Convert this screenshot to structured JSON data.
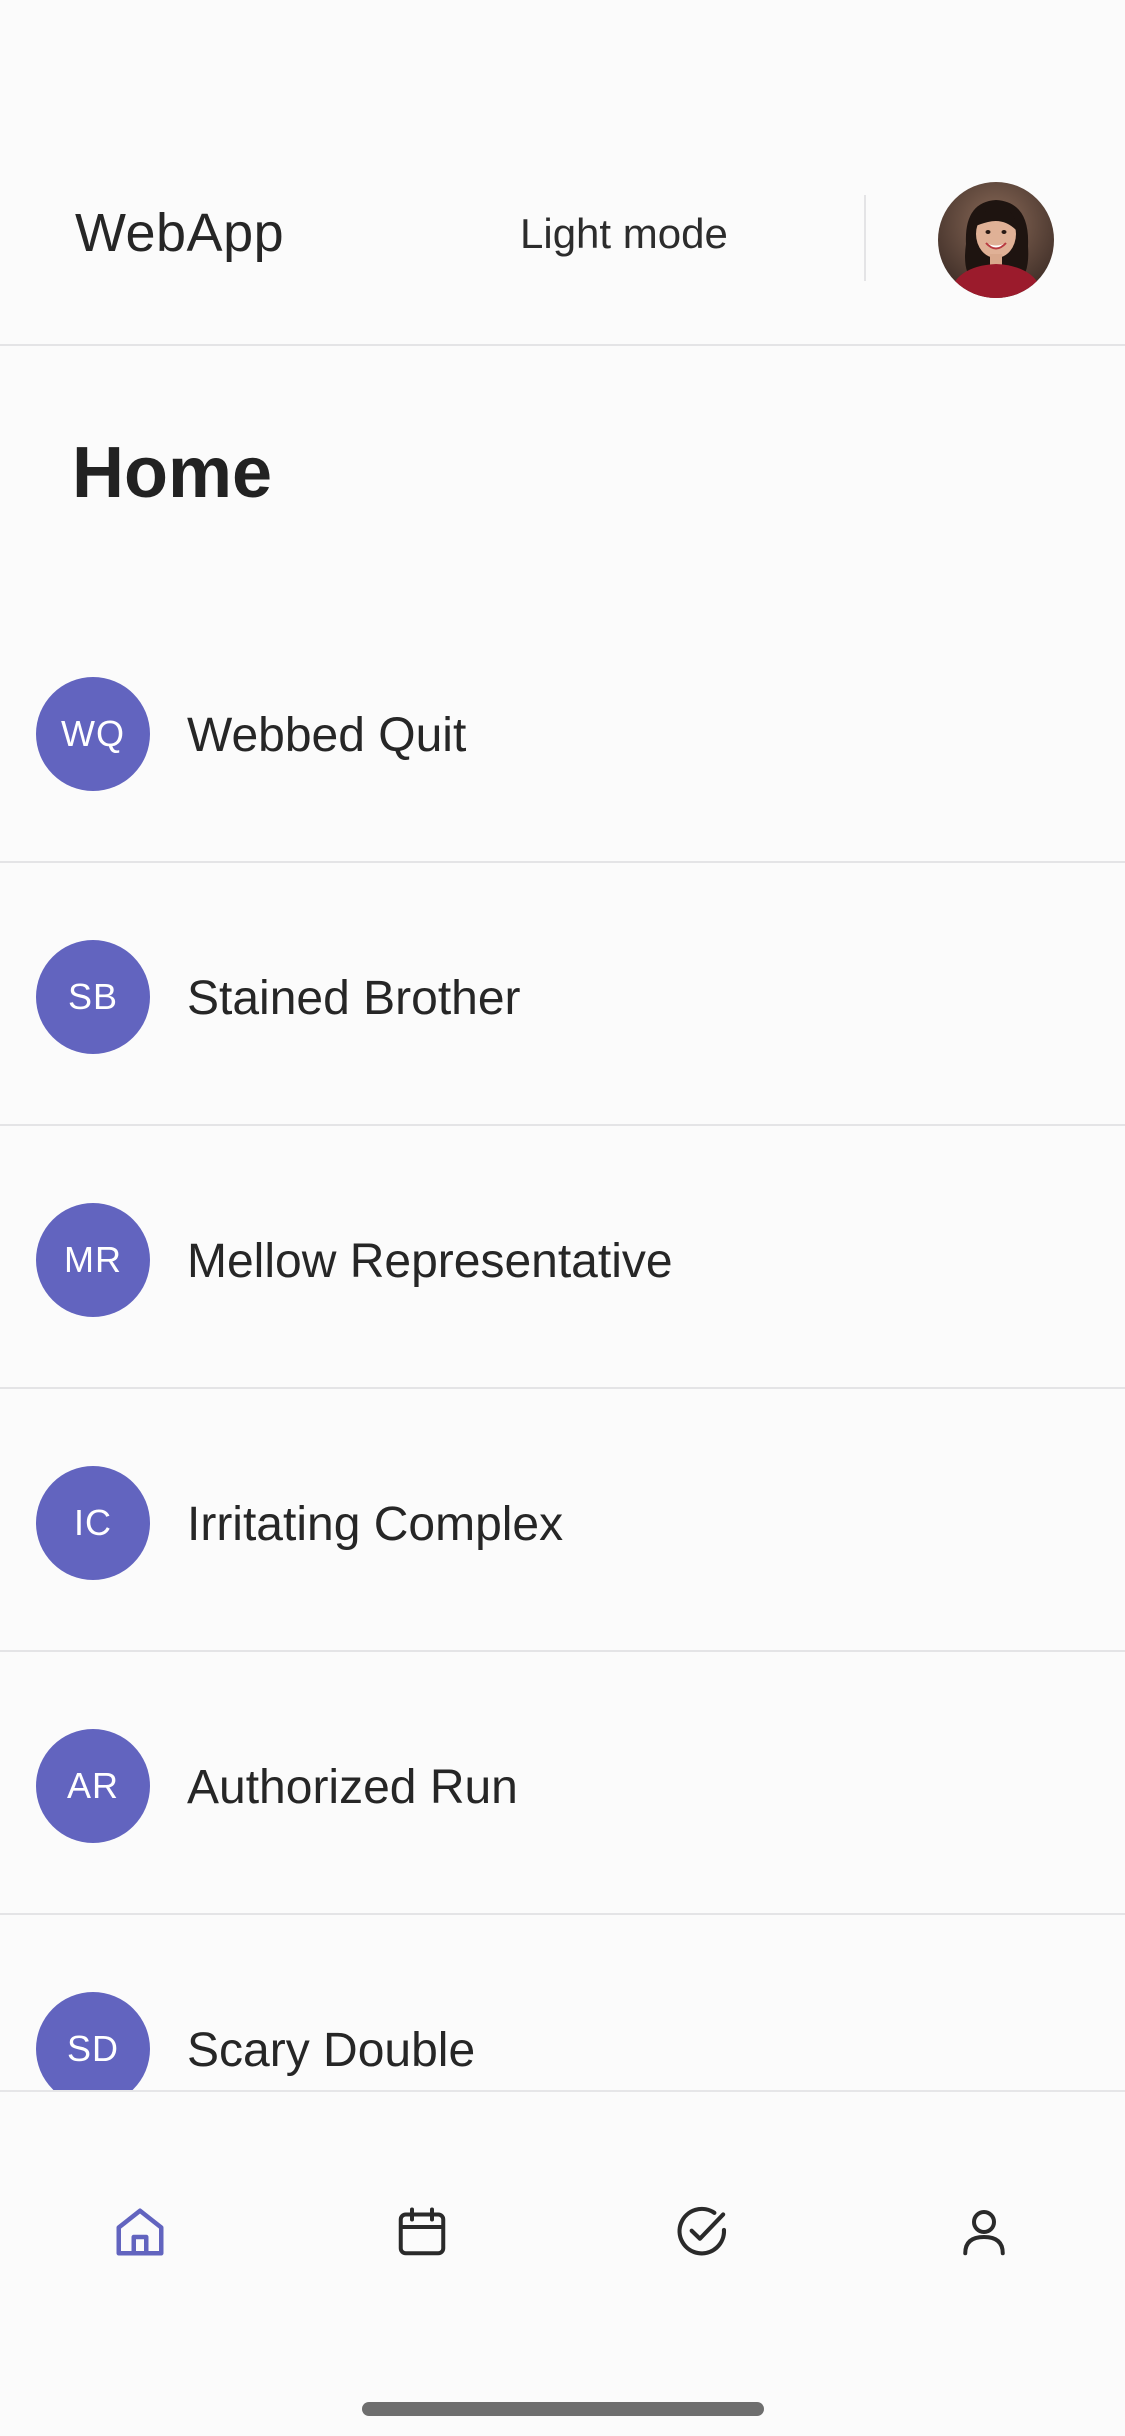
{
  "header": {
    "app_title": "WebApp",
    "mode_toggle_label": "Light mode"
  },
  "page": {
    "title": "Home"
  },
  "list": {
    "items": [
      {
        "initials": "WQ",
        "name": "Webbed Quit"
      },
      {
        "initials": "SB",
        "name": "Stained Brother"
      },
      {
        "initials": "MR",
        "name": "Mellow Representative"
      },
      {
        "initials": "IC",
        "name": "Irritating Complex"
      },
      {
        "initials": "AR",
        "name": "Authorized Run"
      },
      {
        "initials": "SD",
        "name": "Scary Double"
      }
    ]
  },
  "bottom_nav": {
    "items": [
      {
        "icon": "home-icon",
        "active": true
      },
      {
        "icon": "calendar-icon",
        "active": false
      },
      {
        "icon": "check-circle-icon",
        "active": false
      },
      {
        "icon": "user-icon",
        "active": false
      }
    ]
  },
  "colors": {
    "accent": "#6264bf",
    "text": "#262626",
    "divider": "#e4e4e6",
    "background": "#fbfbfb"
  }
}
